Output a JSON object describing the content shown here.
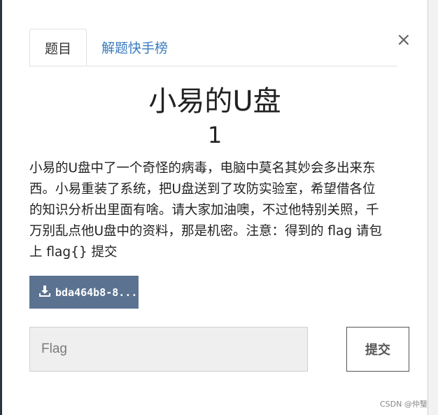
{
  "tabs": {
    "active": "题目",
    "other": "解题快手榜"
  },
  "close_label": "×",
  "challenge": {
    "title": "小易的U盘",
    "points": "1",
    "description_lines": [
      "小易的U盘中了一个奇怪的病毒，电脑中莫名其妙会多出来东",
      "西。小易重装了系统，把U盘送到了攻防实验室，希望借各位",
      "的知识分析出里面有啥。请大家加油噢，不过他特别关照，千",
      "万别乱点他U盘中的资料，那是机密。注意：得到的 flag 请包",
      "上 flag{} 提交"
    ]
  },
  "download": {
    "label": "bda464b8-8...",
    "icon": "download-icon"
  },
  "flag_input": {
    "placeholder": "Flag",
    "value": ""
  },
  "submit_label": "提交",
  "watermark": "CSDN @仲瑿",
  "colors": {
    "download_bg": "#5b7391",
    "tab_link": "#3a7bbf"
  }
}
